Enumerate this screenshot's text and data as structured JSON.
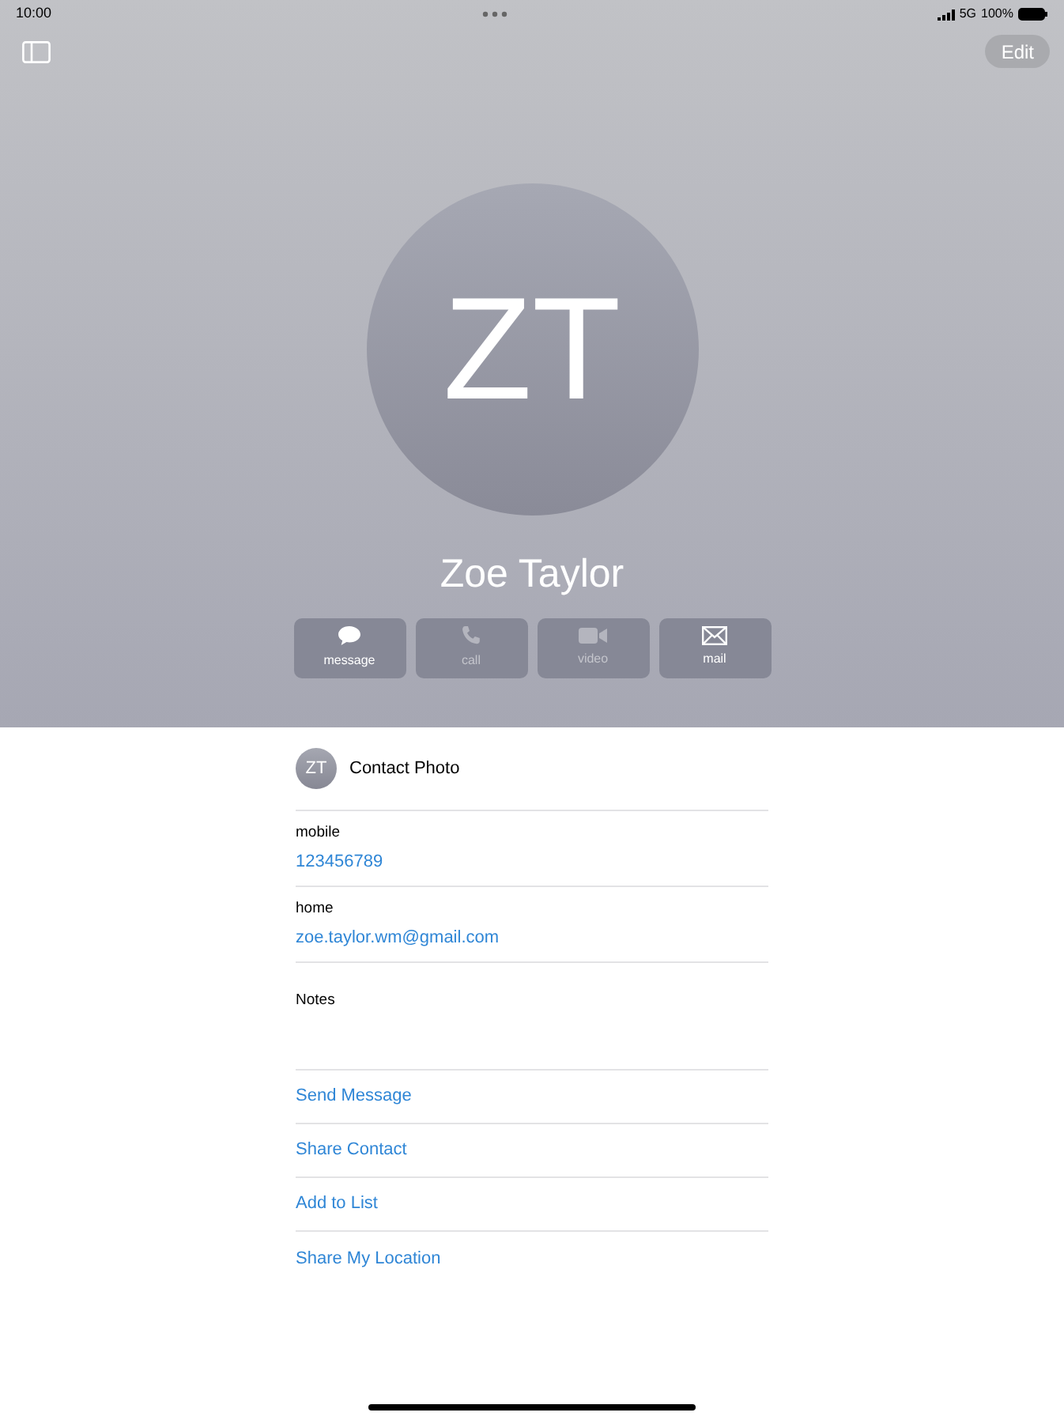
{
  "status_bar": {
    "time": "10:00",
    "network": "5G",
    "battery": "100%"
  },
  "nav": {
    "edit": "Edit"
  },
  "contact": {
    "initials": "ZT",
    "name": "Zoe Taylor"
  },
  "actions": [
    {
      "kind": "message",
      "label": "message",
      "disabled": false
    },
    {
      "kind": "call",
      "label": "call",
      "disabled": true
    },
    {
      "kind": "video",
      "label": "video",
      "disabled": true
    },
    {
      "kind": "mail",
      "label": "mail",
      "disabled": false
    }
  ],
  "photo_row": {
    "initials": "ZT",
    "label": "Contact Photo"
  },
  "fields": [
    {
      "label": "mobile",
      "value": "123456789"
    },
    {
      "label": "home",
      "value": "zoe.taylor.wm@gmail.com"
    }
  ],
  "notes": {
    "label": "Notes"
  },
  "links": [
    "Send Message",
    "Share Contact",
    "Add to List",
    "Share My Location"
  ]
}
